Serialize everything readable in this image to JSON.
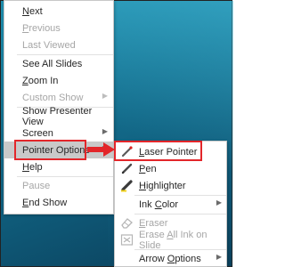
{
  "main_menu": {
    "items": [
      {
        "label": "Next",
        "ul": "N",
        "rest": "ext",
        "disabled": false
      },
      {
        "label": "Previous",
        "ul": "P",
        "rest": "revious",
        "disabled": true
      },
      {
        "label": "Last Viewed",
        "ul": "",
        "rest": "Last Viewed",
        "disabled": true
      },
      {
        "label": "See All Slides",
        "ul": "",
        "rest": "See All Slides",
        "disabled": false
      },
      {
        "label": "Zoom In",
        "ul": "Z",
        "rest": "oom In",
        "disabled": false
      },
      {
        "label": "Custom Show",
        "ul": "",
        "rest": "Custom Show",
        "disabled": true
      },
      {
        "label": "Show Presenter View",
        "ul": "",
        "rest": "Show Presenter View",
        "disabled": false
      },
      {
        "label": "Screen",
        "ul": "",
        "rest": "Screen",
        "disabled": false
      },
      {
        "label": "Pointer Options",
        "ul": "",
        "rest": "Pointer Options",
        "disabled": false
      },
      {
        "label": "Help",
        "ul": "H",
        "rest": "elp",
        "disabled": false
      },
      {
        "label": "Pause",
        "ul": "",
        "rest": "Pause",
        "disabled": true
      },
      {
        "label": "End Show",
        "ul": "E",
        "rest": "nd Show",
        "disabled": false
      }
    ]
  },
  "sub_menu": {
    "items": [
      {
        "label": "Laser Pointer",
        "icon": "laser-pointer-icon",
        "disabled": false
      },
      {
        "label": "Pen",
        "icon": "pen-icon",
        "disabled": false
      },
      {
        "label": "Highlighter",
        "icon": "highlighter-icon",
        "disabled": false
      },
      {
        "label": "Ink Color",
        "disabled": false
      },
      {
        "label": "Eraser",
        "icon": "eraser-icon",
        "disabled": true
      },
      {
        "label": "Erase All Ink on Slide",
        "icon": "erase-all-icon",
        "disabled": true
      },
      {
        "label": "Arrow Options",
        "disabled": false
      }
    ]
  },
  "colors": {
    "highlight_box": "#e3262a",
    "active_item_bg": "#c9c9c9",
    "slide_bg": "#14708f"
  }
}
